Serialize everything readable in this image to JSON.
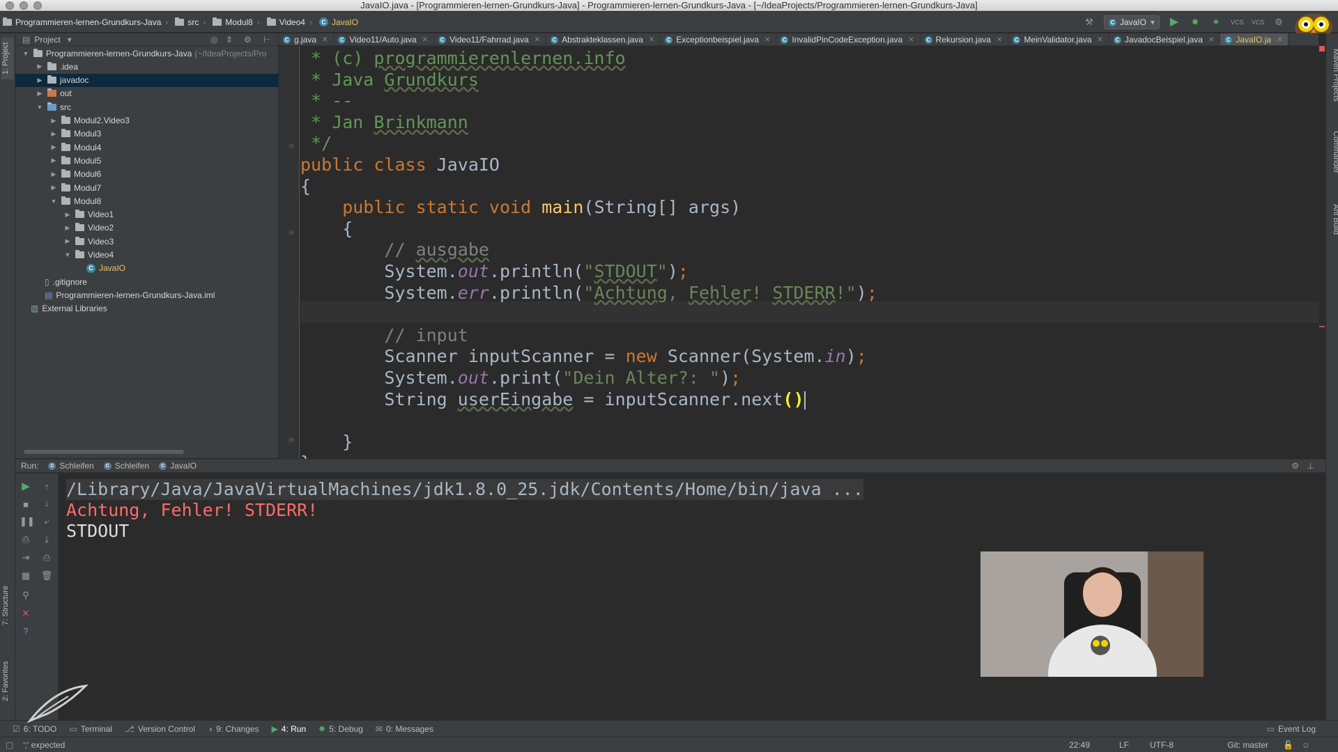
{
  "window": {
    "title": "JavaIO.java - [Programmieren-lernen-Grundkurs-Java] - Programmieren-lernen-Grundkurs-Java - [~/IdeaProjects/Programmieren-lernen-Grundkurs-Java]"
  },
  "breadcrumbs": [
    "Programmieren-lernen-Grundkurs-Java",
    "src",
    "Modul8",
    "Video4",
    "JavaIO"
  ],
  "toolbar": {
    "run_config": "JavaIO",
    "run_icon": "play-icon",
    "debug_icon": "bug-icon"
  },
  "project_panel": {
    "title": "Project",
    "tree": [
      {
        "label": "Programmieren-lernen-Grundkurs-Java",
        "suffix": "(~/IdeaProjects/Pro",
        "depth": 0,
        "expanded": true,
        "icon": "folder-icon"
      },
      {
        "label": ".idea",
        "depth": 1,
        "expanded": false,
        "icon": "folder-icon"
      },
      {
        "label": "javadoc",
        "depth": 1,
        "expanded": false,
        "icon": "folder-icon",
        "selected": true
      },
      {
        "label": "out",
        "depth": 1,
        "expanded": false,
        "icon": "folder-icon"
      },
      {
        "label": "src",
        "depth": 1,
        "expanded": true,
        "icon": "folder-icon"
      },
      {
        "label": "Modul2.Video3",
        "depth": 2,
        "expanded": false,
        "icon": "folder-icon"
      },
      {
        "label": "Modul3",
        "depth": 2,
        "expanded": false,
        "icon": "folder-icon"
      },
      {
        "label": "Modul4",
        "depth": 2,
        "expanded": false,
        "icon": "folder-icon"
      },
      {
        "label": "Modul5",
        "depth": 2,
        "expanded": false,
        "icon": "folder-icon"
      },
      {
        "label": "Modul6",
        "depth": 2,
        "expanded": false,
        "icon": "folder-icon"
      },
      {
        "label": "Modul7",
        "depth": 2,
        "expanded": false,
        "icon": "folder-icon"
      },
      {
        "label": "Modul8",
        "depth": 2,
        "expanded": true,
        "icon": "folder-icon"
      },
      {
        "label": "Video1",
        "depth": 3,
        "expanded": false,
        "icon": "folder-icon"
      },
      {
        "label": "Video2",
        "depth": 3,
        "expanded": false,
        "icon": "folder-icon"
      },
      {
        "label": "Video3",
        "depth": 3,
        "expanded": false,
        "icon": "folder-icon"
      },
      {
        "label": "Video4",
        "depth": 3,
        "expanded": true,
        "icon": "folder-icon"
      },
      {
        "label": "JavaIO",
        "depth": 4,
        "leaf": true,
        "icon": "class-icon"
      },
      {
        "label": ".gitignore",
        "depth": 1,
        "leaf": true,
        "icon": "file-icon"
      },
      {
        "label": "Programmieren-lernen-Grundkurs-Java.iml",
        "depth": 1,
        "leaf": true,
        "icon": "module-icon"
      },
      {
        "label": "External Libraries",
        "depth": 0,
        "leaf": true,
        "icon": "library-icon"
      }
    ]
  },
  "editor_tabs": [
    {
      "label": "g.java"
    },
    {
      "label": "Video11/Auto.java"
    },
    {
      "label": "Video11/Fahrrad.java"
    },
    {
      "label": "Abstrakteklassen.java"
    },
    {
      "label": "Exceptionbeispiel.java"
    },
    {
      "label": "InvalidPinCodeException.java"
    },
    {
      "label": "Rekursion.java"
    },
    {
      "label": "MeinValidator.java"
    },
    {
      "label": "JavadocBeispiel.java"
    },
    {
      "label": "JavaIO.ja",
      "active": true
    }
  ],
  "code": [
    [
      {
        "t": " * (c) ",
        "c": "doc"
      },
      {
        "t": "programmierenlernen.info",
        "c": "doc und"
      }
    ],
    [
      {
        "t": " * Java ",
        "c": "doc"
      },
      {
        "t": "Grundkurs",
        "c": "doc und"
      }
    ],
    [
      {
        "t": " * --",
        "c": "doc"
      }
    ],
    [
      {
        "t": " * Jan ",
        "c": "doc"
      },
      {
        "t": "Brinkmann",
        "c": "doc und"
      }
    ],
    [
      {
        "t": " */",
        "c": "doc"
      }
    ],
    [
      {
        "t": "public class ",
        "c": "kw"
      },
      {
        "t": "JavaIO",
        "c": ""
      }
    ],
    [
      {
        "t": "{",
        "c": ""
      }
    ],
    [
      {
        "t": "    public static void ",
        "c": "kw"
      },
      {
        "t": "main",
        "c": "fn"
      },
      {
        "t": "(String[] args)",
        "c": ""
      }
    ],
    [
      {
        "t": "    {",
        "c": ""
      }
    ],
    [
      {
        "t": "        // ",
        "c": "cm"
      },
      {
        "t": "ausgabe",
        "c": "cm und"
      }
    ],
    [
      {
        "t": "        System.",
        "c": ""
      },
      {
        "t": "out",
        "c": "fld"
      },
      {
        "t": ".println(",
        "c": ""
      },
      {
        "t": "\"",
        "c": "str"
      },
      {
        "t": "STDOUT",
        "c": "str und"
      },
      {
        "t": "\"",
        "c": "str"
      },
      {
        "t": ")",
        "c": ""
      },
      {
        "t": ";",
        "c": "pun"
      }
    ],
    [
      {
        "t": "        System.",
        "c": ""
      },
      {
        "t": "err",
        "c": "fld"
      },
      {
        "t": ".println(",
        "c": ""
      },
      {
        "t": "\"",
        "c": "str"
      },
      {
        "t": "Achtung",
        "c": "str und"
      },
      {
        "t": ", ",
        "c": "str"
      },
      {
        "t": "Fehler",
        "c": "str und"
      },
      {
        "t": "! ",
        "c": "str"
      },
      {
        "t": "STDERR",
        "c": "str und"
      },
      {
        "t": "!\"",
        "c": "str"
      },
      {
        "t": ")",
        "c": ""
      },
      {
        "t": ";",
        "c": "pun"
      }
    ],
    [
      {
        "t": "",
        "c": ""
      }
    ],
    [
      {
        "t": "        // input",
        "c": "cm"
      }
    ],
    [
      {
        "t": "        Scanner inputScanner = ",
        "c": ""
      },
      {
        "t": "new ",
        "c": "kw"
      },
      {
        "t": "Scanner(System.",
        "c": ""
      },
      {
        "t": "in",
        "c": "fld"
      },
      {
        "t": ")",
        "c": ""
      },
      {
        "t": ";",
        "c": "pun"
      }
    ],
    [
      {
        "t": "        System.",
        "c": ""
      },
      {
        "t": "out",
        "c": "fld"
      },
      {
        "t": ".print(",
        "c": ""
      },
      {
        "t": "\"Dein Alter?: \"",
        "c": "str"
      },
      {
        "t": ")",
        "c": ""
      },
      {
        "t": ";",
        "c": "pun"
      }
    ],
    [
      {
        "t": "        String ",
        "c": ""
      },
      {
        "t": "userEingabe",
        "c": "und"
      },
      {
        "t": " = inputScanner.next",
        "c": ""
      },
      {
        "t": "()",
        "c": "match"
      },
      {
        "t": "|caret|",
        "c": "caret"
      }
    ],
    [
      {
        "t": "",
        "c": ""
      }
    ],
    [
      {
        "t": "    }",
        "c": ""
      }
    ],
    [
      {
        "t": "}",
        "c": ""
      }
    ]
  ],
  "run_panel": {
    "label": "Run:",
    "tabs": [
      "Schleifen",
      "Schleifen",
      "JavaIO"
    ],
    "output": [
      {
        "text": "/Library/Java/JavaVirtualMachines/jdk1.8.0_25.jdk/Contents/Home/bin/java ...",
        "color": "#a9b7c6",
        "bg": "#3a3a3a"
      },
      {
        "text": "Achtung, Fehler! STDERR!",
        "color": "#ff6b68"
      },
      {
        "text": "STDOUT",
        "color": "#dddddd"
      }
    ]
  },
  "tool_windows": [
    {
      "label": "6: TODO",
      "icon": "todo-icon"
    },
    {
      "label": "Terminal",
      "icon": "terminal-icon"
    },
    {
      "label": "Version Control",
      "icon": "vcs-icon"
    },
    {
      "label": "9: Changes",
      "icon": "changes-icon"
    },
    {
      "label": "4: Run",
      "icon": "play-icon",
      "active": true
    },
    {
      "label": "5: Debug",
      "icon": "bug-icon"
    },
    {
      "label": "0: Messages",
      "icon": "messages-icon"
    }
  ],
  "event_log": "Event Log",
  "status": {
    "message": "';' expected",
    "position": "22:49",
    "line_sep": "LF",
    "encoding": "UTF-8",
    "vcs": "Git: master"
  },
  "side_tabs": {
    "left": [
      "1: Project",
      "7: Structure",
      "2: Favorites"
    ],
    "right": [
      "Maven Projects",
      "Commander",
      "Ant Build"
    ]
  },
  "colors": {
    "accent": "#0d293e",
    "keyword": "#cc7832",
    "string": "#6a8759",
    "error": "#ff6b68",
    "run_green": "#59a869"
  }
}
